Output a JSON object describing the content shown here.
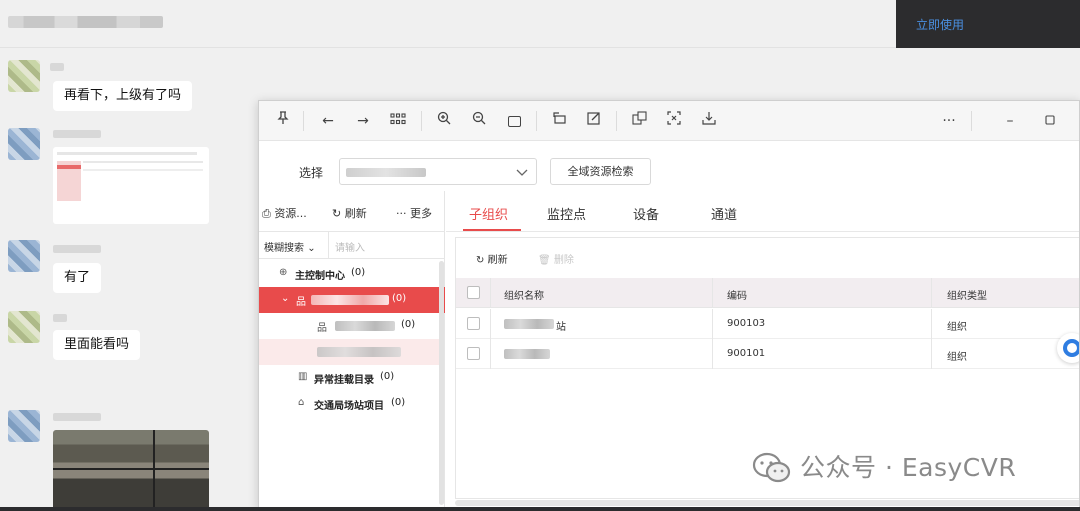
{
  "chat": {
    "toast_link": "立即使用",
    "messages": [
      "再看下，上级有了吗",
      "有了",
      "里面能看吗"
    ]
  },
  "window": {
    "select_label": "选择",
    "global_search_button": "全域资源检索",
    "left_tools": {
      "resources": "资源...",
      "refresh": "刷新",
      "more": "更多"
    },
    "search": {
      "mode": "模糊搜索",
      "placeholder": "请输入"
    },
    "tree": [
      {
        "label": "主控制中心",
        "count": "(0)"
      },
      {
        "label": "",
        "count": "(0)"
      },
      {
        "label": "",
        "count": "(0)"
      },
      {
        "label": "",
        "count": ""
      },
      {
        "label": "异常挂载目录",
        "count": "(0)"
      },
      {
        "label": "交通局场站项目",
        "count": "(0)"
      }
    ],
    "tabs": [
      "子组织",
      "监控点",
      "设备",
      "通道"
    ],
    "actions": {
      "refresh": "刷新",
      "delete": "删除"
    },
    "table": {
      "headers": [
        "组织名称",
        "编码",
        "组织类型"
      ],
      "rows": [
        {
          "name": "站",
          "code": "900103",
          "type": "组织"
        },
        {
          "name": "",
          "code": "900101",
          "type": "组织"
        }
      ]
    }
  },
  "watermark": "公众号 · EasyCVR",
  "colors": {
    "accent": "#e84b4b",
    "link": "#4a90e2",
    "toast_bg": "#2c2c2e"
  }
}
